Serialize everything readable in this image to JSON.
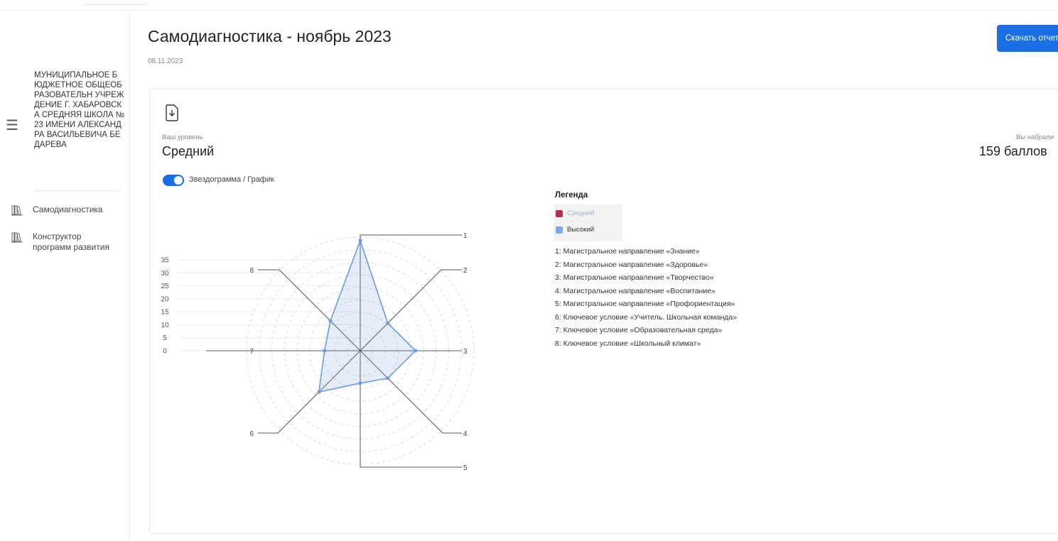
{
  "organization": {
    "name": "МУНИЦИПАЛЬНОЕ БЮДЖЕТНОЕ ОБЩЕОБРАЗОВАТЕЛЬН УЧРЕЖДЕНИЕ Г. ХАБАРОВСКА СРЕДНЯЯ ШКОЛА № 23 ИМЕНИ АЛЕКСАНДРА ВАСИЛЬЕВИЧА БЕДАРЕВА"
  },
  "sidebar": {
    "items": [
      {
        "label": "Самодиагностика",
        "icon": "books-icon"
      },
      {
        "label": "Конструктор программ развития",
        "icon": "books-icon"
      }
    ]
  },
  "header": {
    "title": "Самодиагностика - ноябрь 2023",
    "date": "08.11.2023",
    "download_label": "Скачать отчет"
  },
  "level": {
    "caption": "Ваш уровень",
    "value": "Средний"
  },
  "score": {
    "caption": "Вы набрали",
    "value": "159 баллов"
  },
  "toggle": {
    "label": "Звездограмма / График",
    "on": true
  },
  "legend": {
    "title": "Легенда",
    "series": [
      {
        "name": "Средний",
        "color": "#b0304f",
        "muted": true
      },
      {
        "name": "Высокий",
        "color": "#7fa6e6",
        "muted": false
      }
    ],
    "axes": [
      "1: Магистральное направление «Знание»",
      "2: Магистральное направление «Здоровье»",
      "3: Магистральное направление «Творчество»",
      "4: Магистральное направление «Воспитание»",
      "5: Магистральное направление «Профориентация»",
      "6: Ключевое условие «Учитель. Школьная команда»",
      "7: Ключевое условие «Образовательная среда»",
      "8: Ключевое условие «Школьный климат»"
    ]
  },
  "chart_data": {
    "type": "radar",
    "axis_labels": [
      "1",
      "2",
      "3",
      "4",
      "5",
      "6",
      "7",
      "8"
    ],
    "r_ticks": [
      0,
      5,
      10,
      15,
      20,
      25,
      30,
      35
    ],
    "rlim": [
      0,
      35
    ],
    "series": [
      {
        "name": "Высокий",
        "color": "#6f9ae0",
        "values": [
          34,
          12,
          17,
          12,
          10,
          18,
          11,
          13
        ]
      }
    ]
  }
}
